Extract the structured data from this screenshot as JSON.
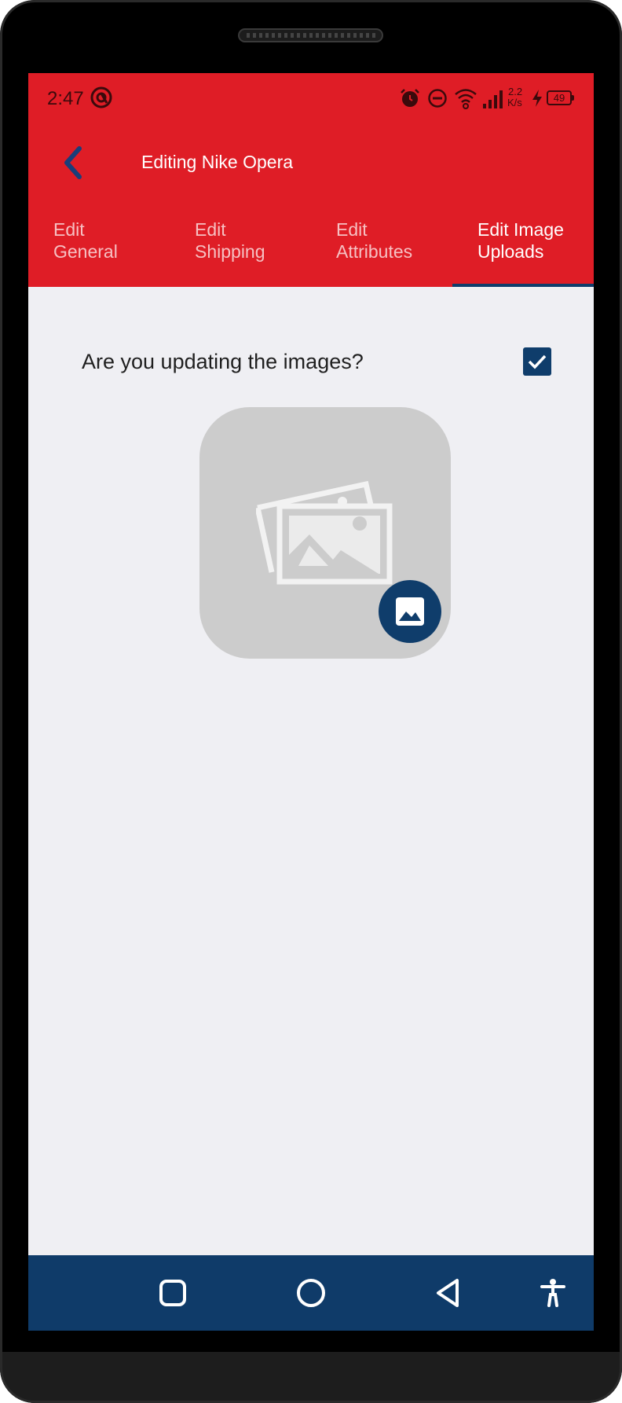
{
  "status_bar": {
    "time": "2:47",
    "network_speed_value": "2.2",
    "network_speed_unit": "K/s",
    "battery": "49",
    "icons": [
      "sync-icon",
      "alarm-icon",
      "do-not-disturb-icon",
      "wifi-icon",
      "cellular-signal-icon",
      "charging-icon",
      "battery-icon"
    ]
  },
  "header": {
    "title": "Editing Nike Opera",
    "back_icon": "chevron-left-icon"
  },
  "tabs": [
    {
      "line1": "Edit",
      "line2": "General",
      "active": false
    },
    {
      "line1": "Edit",
      "line2": "Shipping",
      "active": false
    },
    {
      "line1": "Edit",
      "line2": "Attributes",
      "active": false
    },
    {
      "line1": "Edit Image",
      "line2": "Uploads",
      "active": true
    }
  ],
  "form": {
    "question": "Are you updating the images?",
    "updating_images_checked": true
  },
  "image_picker": {
    "placeholder_icon": "image-placeholder-icon",
    "button_icon": "gallery-icon"
  },
  "nav_bar": {
    "buttons": [
      "recents-square-icon",
      "home-circle-icon",
      "back-triangle-icon",
      "accessibility-icon"
    ]
  },
  "colors": {
    "app_bar": "#df1d26",
    "primary_dark": "#0f3d6b",
    "background": "#efeff3",
    "image_placeholder": "#cccccc"
  }
}
